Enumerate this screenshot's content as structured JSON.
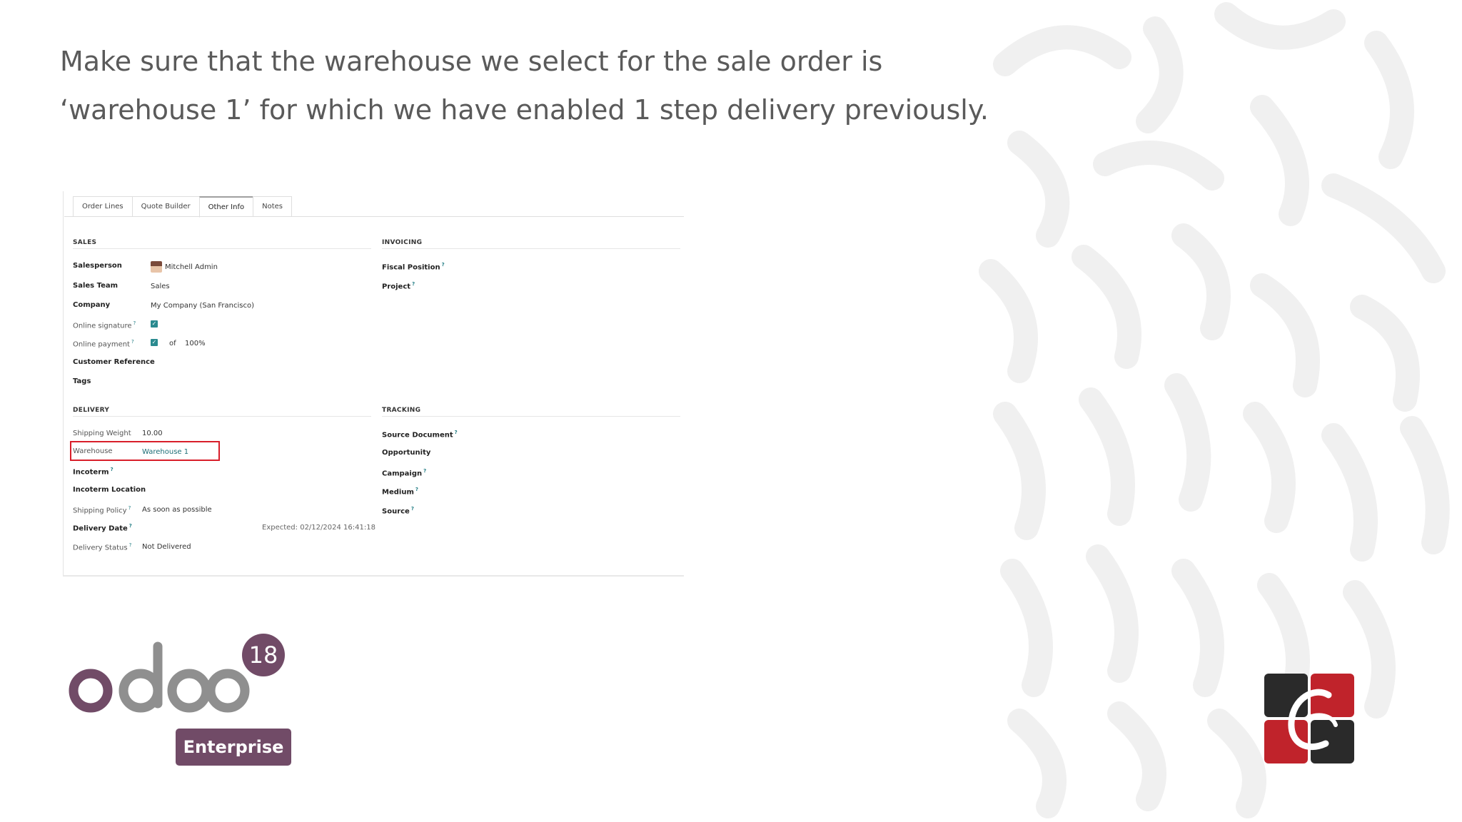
{
  "slide": {
    "heading_line1": "Make sure that the warehouse we select for the sale order is",
    "heading_line2": "‘warehouse 1’ for which we have enabled 1 step delivery previously."
  },
  "tabs": [
    {
      "label": "Order Lines",
      "active": false
    },
    {
      "label": "Quote Builder",
      "active": false
    },
    {
      "label": "Other Info",
      "active": true
    },
    {
      "label": "Notes",
      "active": false
    }
  ],
  "sales": {
    "title": "SALES",
    "salesperson_label": "Salesperson",
    "salesperson_value": "Mitchell Admin",
    "sales_team_label": "Sales Team",
    "sales_team_value": "Sales",
    "company_label": "Company",
    "company_value": "My Company (San Francisco)",
    "online_signature_label": "Online signature",
    "online_signature_checked": true,
    "online_payment_label": "Online payment",
    "online_payment_checked": true,
    "online_payment_of": "of",
    "online_payment_percent": "100%",
    "customer_reference_label": "Customer Reference",
    "tags_label": "Tags"
  },
  "invoicing": {
    "title": "INVOICING",
    "fiscal_position_label": "Fiscal Position",
    "project_label": "Project"
  },
  "delivery": {
    "title": "DELIVERY",
    "shipping_weight_label": "Shipping Weight",
    "shipping_weight_value": "10.00",
    "warehouse_label": "Warehouse",
    "warehouse_value": "Warehouse 1",
    "incoterm_label": "Incoterm",
    "incoterm_location_label": "Incoterm Location",
    "shipping_policy_label": "Shipping Policy",
    "shipping_policy_value": "As soon as possible",
    "delivery_date_label": "Delivery Date",
    "delivery_date_expected": "Expected: 02/12/2024 16:41:18",
    "delivery_status_label": "Delivery Status",
    "delivery_status_value": "Not Delivered"
  },
  "tracking": {
    "title": "TRACKING",
    "source_document_label": "Source Document",
    "opportunity_label": "Opportunity",
    "campaign_label": "Campaign",
    "medium_label": "Medium",
    "source_label": "Source"
  },
  "help_mark": "?",
  "branding": {
    "odoo_wordmark": "odoo",
    "version": "18",
    "edition": "Enterprise",
    "brand_color": "#714b67",
    "accent_red": "#d81e2a"
  }
}
